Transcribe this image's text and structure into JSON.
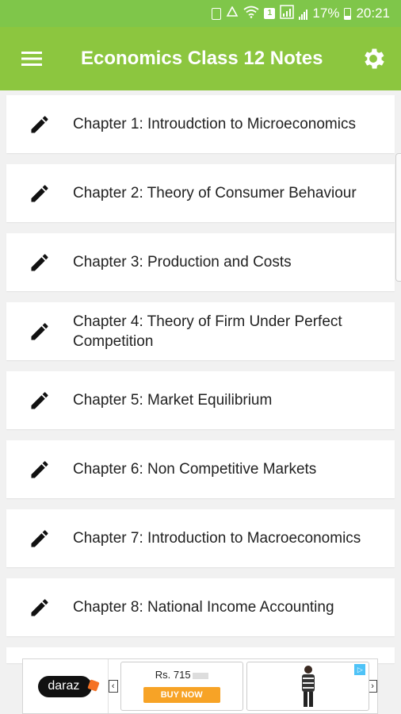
{
  "status_bar": {
    "battery_percent": "17%",
    "time": "20:21",
    "sim_label": "1",
    "icons": [
      "battery-saver-icon",
      "recycle-icon",
      "wifi-icon",
      "sim-icon",
      "signal-box-icon",
      "signal-icon",
      "battery-icon"
    ]
  },
  "app_bar": {
    "title": "Economics Class 12 Notes",
    "menu_icon": "hamburger-menu-icon",
    "settings_icon": "gear-icon",
    "color": "#8cc63f"
  },
  "chapters": [
    {
      "label": "Chapter 1: Introudction to Microeconomics"
    },
    {
      "label": "Chapter 2: Theory of Consumer Behaviour"
    },
    {
      "label": "Chapter 3: Production and Costs"
    },
    {
      "label": "Chapter 4: Theory of Firm Under Perfect Competition"
    },
    {
      "label": "Chapter 5: Market Equilibrium"
    },
    {
      "label": "Chapter 6: Non Competitive Markets"
    },
    {
      "label": "Chapter 7: Introduction to Macroeconomics"
    },
    {
      "label": "Chapter 8: National Income Accounting"
    }
  ],
  "ad": {
    "brand": "daraz",
    "price": "Rs. 715",
    "buy_label": "BUY NOW",
    "prev_arrow": "‹",
    "next_arrow": "›"
  }
}
